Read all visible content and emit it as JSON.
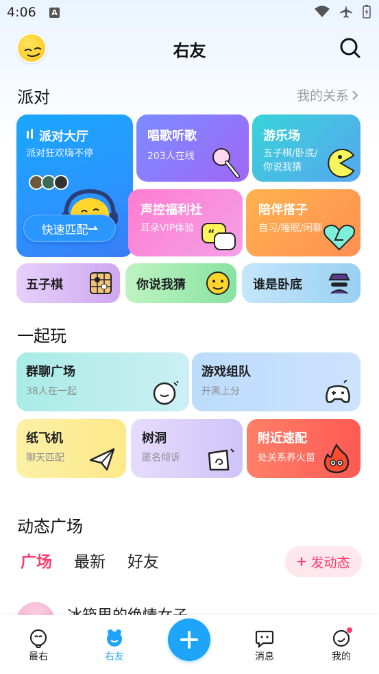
{
  "status_bar": {
    "time": "4:06",
    "notif_letter": "A"
  },
  "header": {
    "title": "右友"
  },
  "party": {
    "title": "派对",
    "more": "我的关系",
    "lobby": {
      "title": "派对大厅",
      "subtitle": "派对狂欢嗨不停",
      "button": "快速匹配"
    },
    "sing": {
      "title": "唱歌听歌",
      "subtitle": "203人在线"
    },
    "park": {
      "title": "游乐场",
      "subtitle_1": "五子棋/卧底/",
      "subtitle_2": "你说我猜"
    },
    "voice": {
      "title": "声控福利社",
      "subtitle": "耳朵VIP体验"
    },
    "partner": {
      "title": "陪伴搭子",
      "subtitle": "自习/睡眠/闲聊"
    },
    "mini": [
      {
        "title": "五子棋",
        "icon": "gomoku-board-icon"
      },
      {
        "title": "你说我猜",
        "icon": "guess-face-icon"
      },
      {
        "title": "谁是卧底",
        "icon": "spy-icon"
      }
    ]
  },
  "play": {
    "title": "一起玩",
    "items": [
      {
        "title": "群聊广场",
        "subtitle": "38人在一起",
        "icon": "chat-bubble-icon"
      },
      {
        "title": "游戏组队",
        "subtitle": "开黑上分",
        "icon": "gamepad-icon"
      },
      {
        "title": "纸飞机",
        "subtitle": "聊天匹配",
        "icon": "paper-plane-icon"
      },
      {
        "title": "树洞",
        "subtitle": "匿名倾诉",
        "icon": "tree-hole-icon"
      },
      {
        "title": "附近速配",
        "subtitle": "处关系养火苗",
        "icon": "flame-icon"
      }
    ]
  },
  "feed": {
    "title": "动态广场",
    "tabs": [
      "广场",
      "最新",
      "好友"
    ],
    "post_button": "发动态",
    "first_item": {
      "name": "冰箱里的绝情女子"
    }
  },
  "bottom_nav": {
    "items": [
      "最右",
      "右友",
      "消息",
      "我的"
    ],
    "active": "右友",
    "accent": "#1ea4f9"
  }
}
